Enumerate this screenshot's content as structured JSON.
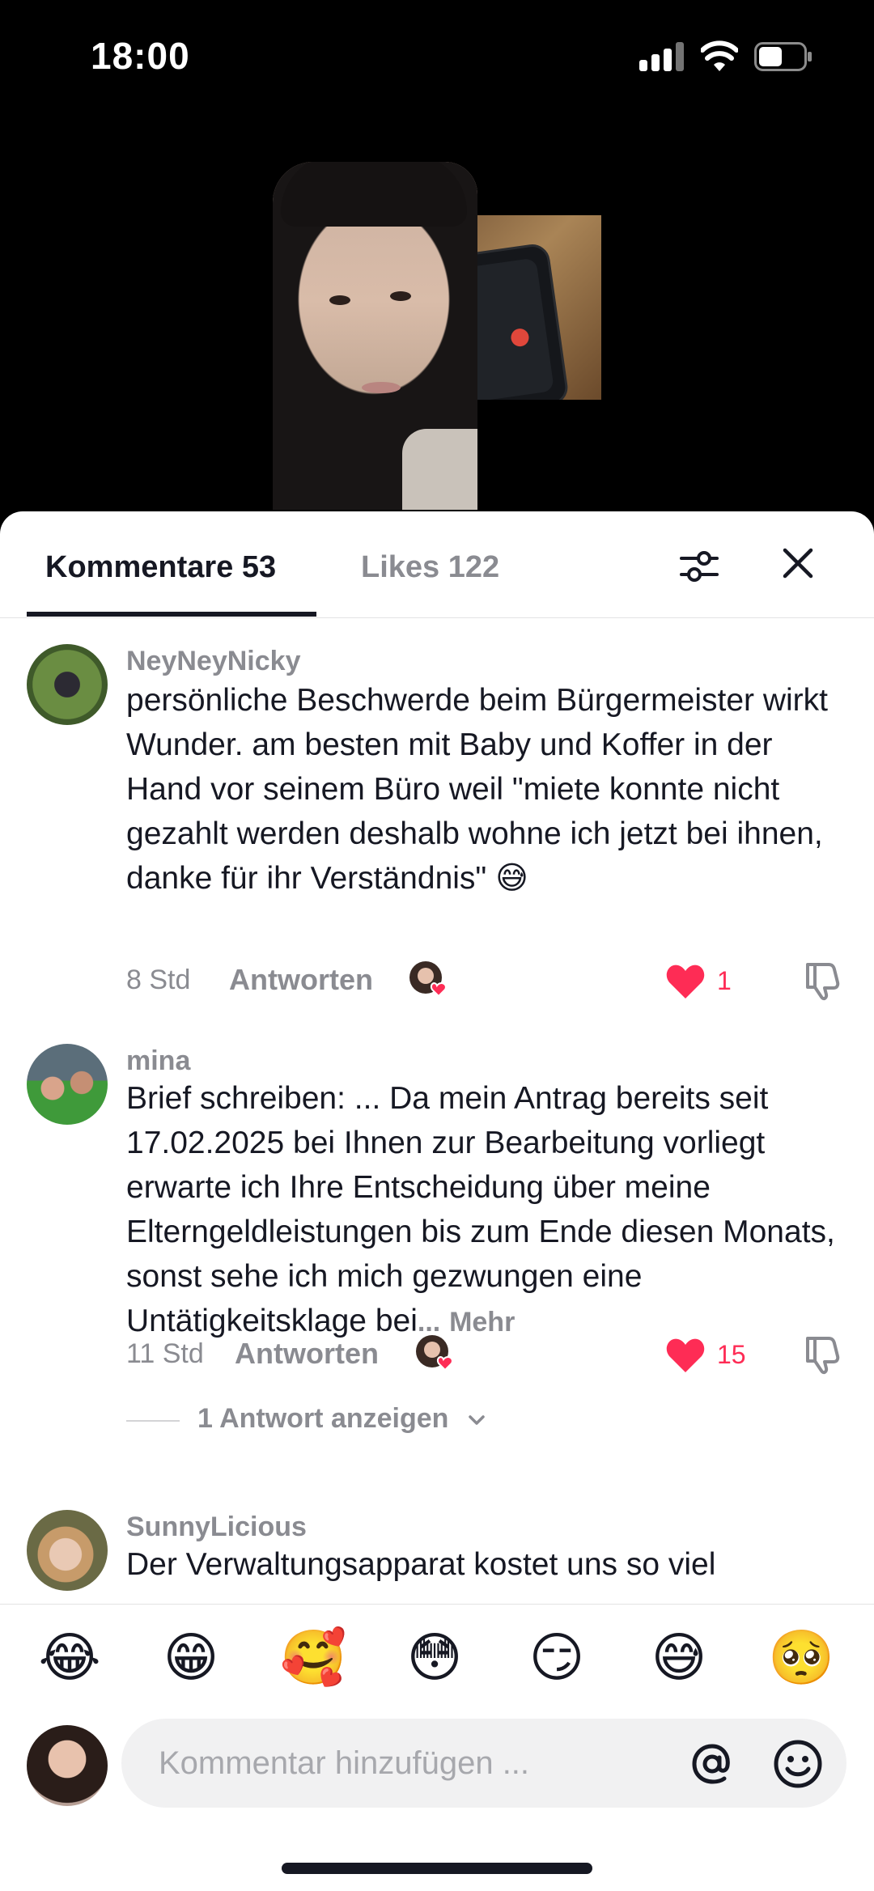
{
  "status_bar": {
    "time": "18:00"
  },
  "tabs": {
    "comments": "Kommentare 53",
    "likes": "Likes 122"
  },
  "comments": [
    {
      "username": "NeyNeyNicky",
      "text": "persönliche Beschwerde beim Bürgermeister wirkt Wunder. am besten mit Baby und Koffer in der Hand vor seinem Büro weil \"miete konnte nicht gezahlt werden deshalb wohne ich jetzt bei ihnen, danke für ihr Verständnis\"",
      "emoji": "😅",
      "time": "8 Std",
      "reply": "Antworten",
      "likes": "1"
    },
    {
      "username": "mina",
      "text": "Brief schreiben: ... Da mein Antrag bereits seit 17.02.2025 bei Ihnen zur Bearbeitung vorliegt erwarte ich Ihre Entscheidung über meine Elterngeldleistungen bis zum Ende diesen Monats, sonst sehe ich mich gezwungen eine Untätigkeitsklage bei",
      "ellipsis": "...",
      "more": "Mehr",
      "time": "11 Std",
      "reply": "Antworten",
      "likes": "15",
      "view_replies": "1 Antwort anzeigen"
    },
    {
      "username": "SunnyLicious",
      "text": "Der Verwaltungsapparat kostet uns so viel"
    }
  ],
  "emoji_bar": [
    "😂",
    "😁",
    "🥰",
    "😳",
    "😏",
    "😅",
    "🥺"
  ],
  "input": {
    "placeholder": "Kommentar hinzufügen ..."
  },
  "colors": {
    "like": "#fe2c55",
    "text": "#161823",
    "muted": "#8a8b91"
  }
}
